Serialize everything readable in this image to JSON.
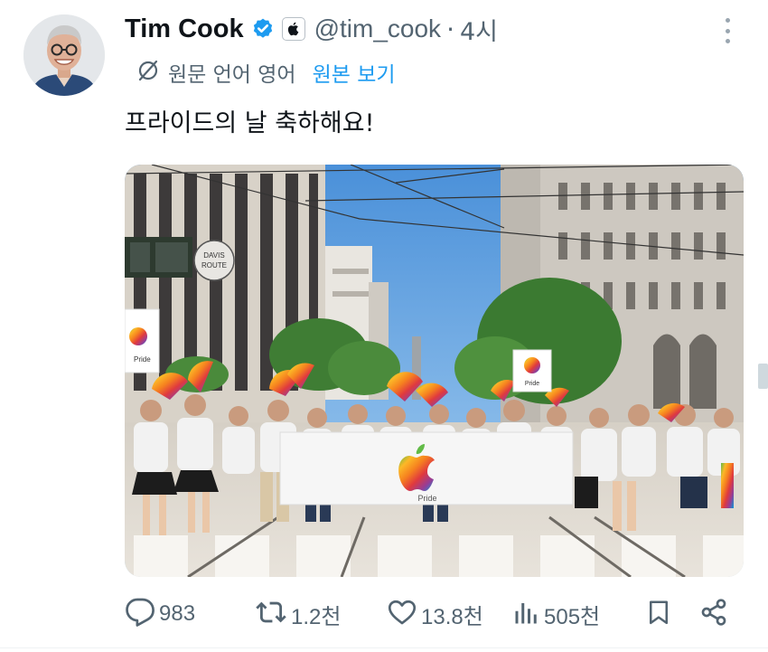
{
  "author": {
    "name": "Tim Cook",
    "handle": "@tim_cook",
    "separator": "·",
    "time": "4시",
    "verified_badge_color": "#1d9bf0",
    "affiliation_icon": "apple-logo-icon"
  },
  "translation": {
    "label": "원문 언어 영어",
    "show_original": "원본 보기"
  },
  "tweet": {
    "text": "프라이드의 날 축하해요!"
  },
  "media": {
    "type": "photo",
    "banner_text": "Pride",
    "sign_text": "Pride",
    "street_sign_lines": [
      "DAVIS",
      "ROUTE"
    ]
  },
  "actions": {
    "replies": "983",
    "retweets": "1.2천",
    "likes": "13.8천",
    "views": "505천"
  },
  "colors": {
    "text_primary": "#0f1419",
    "text_secondary": "#536471",
    "link": "#1d9bf0",
    "divider": "#eff3f4"
  }
}
